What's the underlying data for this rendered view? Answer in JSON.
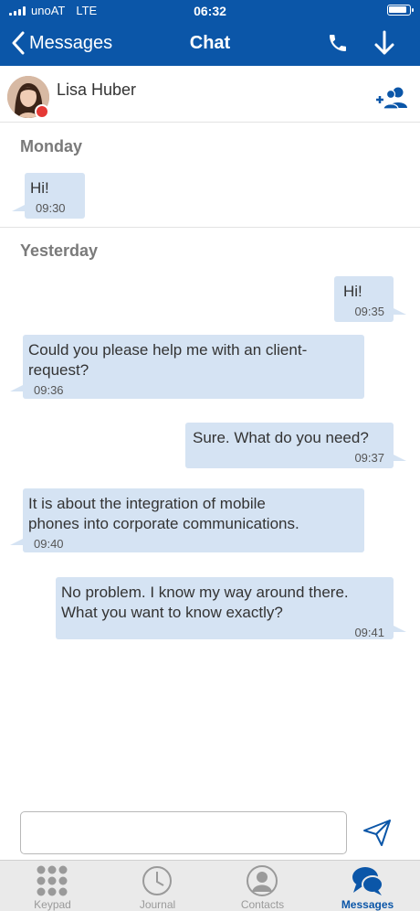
{
  "status": {
    "carrier": "unoAT",
    "network": "LTE",
    "time": "06:32"
  },
  "nav": {
    "back_label": "Messages",
    "title": "Chat"
  },
  "contact": {
    "name": "Lisa Huber",
    "presence_color": "#e53935"
  },
  "days": [
    {
      "label": "Monday"
    },
    {
      "label": "Yesterday"
    }
  ],
  "messages": [
    {
      "dir": "in",
      "text": "Hi!",
      "time": "09:30"
    },
    {
      "dir": "out",
      "text": "Hi!",
      "time": "09:35"
    },
    {
      "dir": "in",
      "text": "Could you please help me with an client-\nrequest?",
      "time": "09:36"
    },
    {
      "dir": "out",
      "text": "Sure. What do you need?",
      "time": "09:37"
    },
    {
      "dir": "in",
      "text": "It is about the integration of mobile\nphones into corporate communications.",
      "time": "09:40"
    },
    {
      "dir": "out",
      "text": "No problem. I know my way around there.\nWhat you want to know exactly?",
      "time": "09:41"
    }
  ],
  "composer": {
    "value": "",
    "placeholder": ""
  },
  "tabs": [
    {
      "label": "Keypad",
      "icon": "keypad-icon"
    },
    {
      "label": "Journal",
      "icon": "clock-icon"
    },
    {
      "label": "Contacts",
      "icon": "person-icon"
    },
    {
      "label": "Messages",
      "icon": "chat-bubbles-icon",
      "active": true
    }
  ],
  "colors": {
    "accent": "#0b56a8",
    "bubble": "#d5e3f3",
    "presence": "#e53935"
  }
}
